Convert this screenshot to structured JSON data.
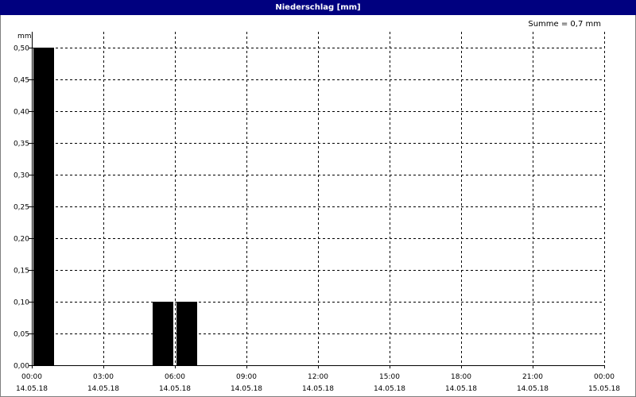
{
  "window": {
    "title": "Niederschlag [mm]"
  },
  "summary": {
    "text": "Summe = 0,7 mm"
  },
  "chart_data": {
    "type": "bar",
    "title": "Niederschlag [mm]",
    "ylabel": "mm",
    "xlabel": "",
    "ylim": [
      0,
      0.5
    ],
    "xlim_hours": [
      0,
      24
    ],
    "yticks": [
      {
        "value": 0.0,
        "label": "0,00"
      },
      {
        "value": 0.05,
        "label": "0,05"
      },
      {
        "value": 0.1,
        "label": "0,10"
      },
      {
        "value": 0.15,
        "label": "0,15"
      },
      {
        "value": 0.2,
        "label": "0,20"
      },
      {
        "value": 0.25,
        "label": "0,25"
      },
      {
        "value": 0.3,
        "label": "0,30"
      },
      {
        "value": 0.35,
        "label": "0,35"
      },
      {
        "value": 0.4,
        "label": "0,40"
      },
      {
        "value": 0.45,
        "label": "0,45"
      },
      {
        "value": 0.5,
        "label": "0,50"
      }
    ],
    "xticks": [
      {
        "hour": 0,
        "time": "00:00",
        "date": "14.05.18"
      },
      {
        "hour": 3,
        "time": "03:00",
        "date": "14.05.18"
      },
      {
        "hour": 6,
        "time": "06:00",
        "date": "14.05.18"
      },
      {
        "hour": 9,
        "time": "09:00",
        "date": "14.05.18"
      },
      {
        "hour": 12,
        "time": "12:00",
        "date": "14.05.18"
      },
      {
        "hour": 15,
        "time": "15:00",
        "date": "14.05.18"
      },
      {
        "hour": 18,
        "time": "18:00",
        "date": "14.05.18"
      },
      {
        "hour": 21,
        "time": "21:00",
        "date": "14.05.18"
      },
      {
        "hour": 24,
        "time": "00:00",
        "date": "15.05.18"
      }
    ],
    "bars": [
      {
        "start_hour": 0,
        "end_hour": 1,
        "value": 0.5
      },
      {
        "start_hour": 5,
        "end_hour": 6,
        "value": 0.1
      },
      {
        "start_hour": 6,
        "end_hour": 7,
        "value": 0.1
      }
    ],
    "grid": true,
    "bar_color": "#000000",
    "grid_color": "#000000",
    "title_bar_color": "#00007f"
  }
}
